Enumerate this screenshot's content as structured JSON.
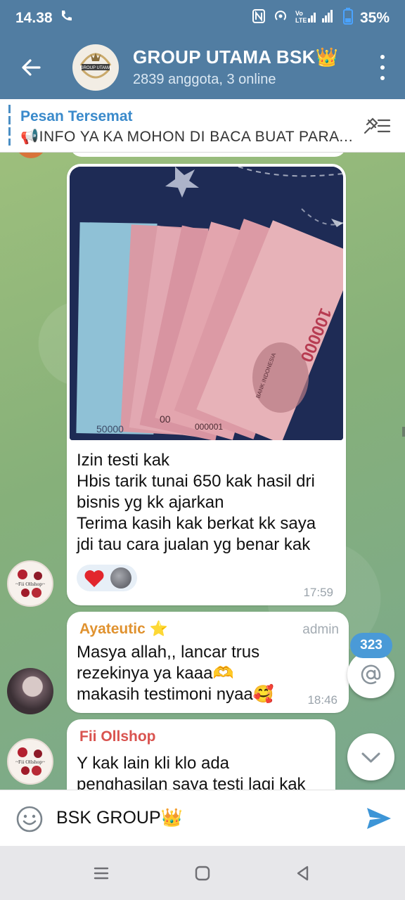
{
  "status": {
    "time": "14.38",
    "battery": "35%"
  },
  "header": {
    "title": "GROUP UTAMA BSK👑",
    "subtitle": "2839 anggota, 3 online"
  },
  "pinned": {
    "title": "Pesan Tersemat",
    "text": "📢INFO YA KA MOHON DI BACA BUAT PARA L..."
  },
  "messages": [
    {
      "type": "photo",
      "lines": [
        "Izin testi kak",
        "Hbis tarik tunai 650 kak hasil dri",
        "bisnis yg kk ajarkan",
        "Terima kasih kak berkat kk saya",
        "jdi tau cara jualan yg benar kak"
      ],
      "reaction": "heart",
      "time": "17:59",
      "photo_texts": {
        "denomination": "100000",
        "edge_value": "50000",
        "serial_a": "00",
        "serial_b": "000001",
        "bank_text": "BANK INDONESIA"
      }
    },
    {
      "type": "text",
      "sender": "Ayateutic",
      "sender_badge": "⭐",
      "role": "admin",
      "lines": [
        "Masya allah,, lancar trus",
        "rezekinya ya kaaa🫶",
        "makasih testimoni nyaa🥰"
      ],
      "time": "18:46"
    },
    {
      "type": "text",
      "sender": "Fii Ollshop",
      "lines": [
        "Y kak lain kli klo ada",
        "penghasilan saya testi lagi kak"
      ]
    }
  ],
  "avatars": {
    "shop_label": "~Fii Ollshop~",
    "group_logo_text": "GROUP UTAMA"
  },
  "mentions_count": "323",
  "composer": {
    "value": "BSK GROUP👑"
  },
  "colors": {
    "header": "#517da2",
    "accent": "#3a8acb",
    "sender_admin": "#e0922f",
    "sender_shop": "#d9534f",
    "badge": "#4a9ad7"
  }
}
